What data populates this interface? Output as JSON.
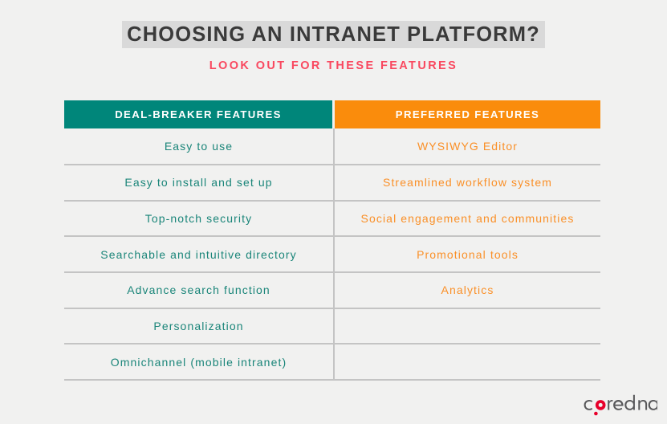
{
  "header": {
    "title": "CHOOSING AN INTRANET PLATFORM?",
    "subtitle": "LOOK OUT FOR THESE FEATURES",
    "title_highlight_color": "#d9d9d9",
    "title_color": "#3a3a3a",
    "subtitle_color": "#f9485f"
  },
  "table": {
    "columns": [
      {
        "label": "DEAL-BREAKER FEATURES",
        "header_bg": "#00867a",
        "text_color": "#1a8579"
      },
      {
        "label": "PREFERRED FEATURES",
        "header_bg": "#fa8c0c",
        "text_color": "#fa9028"
      }
    ],
    "rows": [
      {
        "left": "Easy to use",
        "right": "WYSIWYG Editor"
      },
      {
        "left": "Easy to install and set up",
        "right": "Streamlined workflow system"
      },
      {
        "left": "Top-notch security",
        "right": "Social engagement and communities"
      },
      {
        "left": "Searchable and intuitive directory",
        "right": "Promotional tools"
      },
      {
        "left": "Advance search function",
        "right": "Analytics"
      },
      {
        "left": "Personalization",
        "right": ""
      },
      {
        "left": "Omnichannel (mobile intranet)",
        "right": ""
      }
    ],
    "divider_color": "#c4c4c4"
  },
  "logo": {
    "text_part_1": "c",
    "text_part_2": "re dna",
    "full_name": "core dna",
    "mark_color": "#e8002b",
    "text_color": "#58585a"
  },
  "page": {
    "background": "#f1f1f0"
  }
}
